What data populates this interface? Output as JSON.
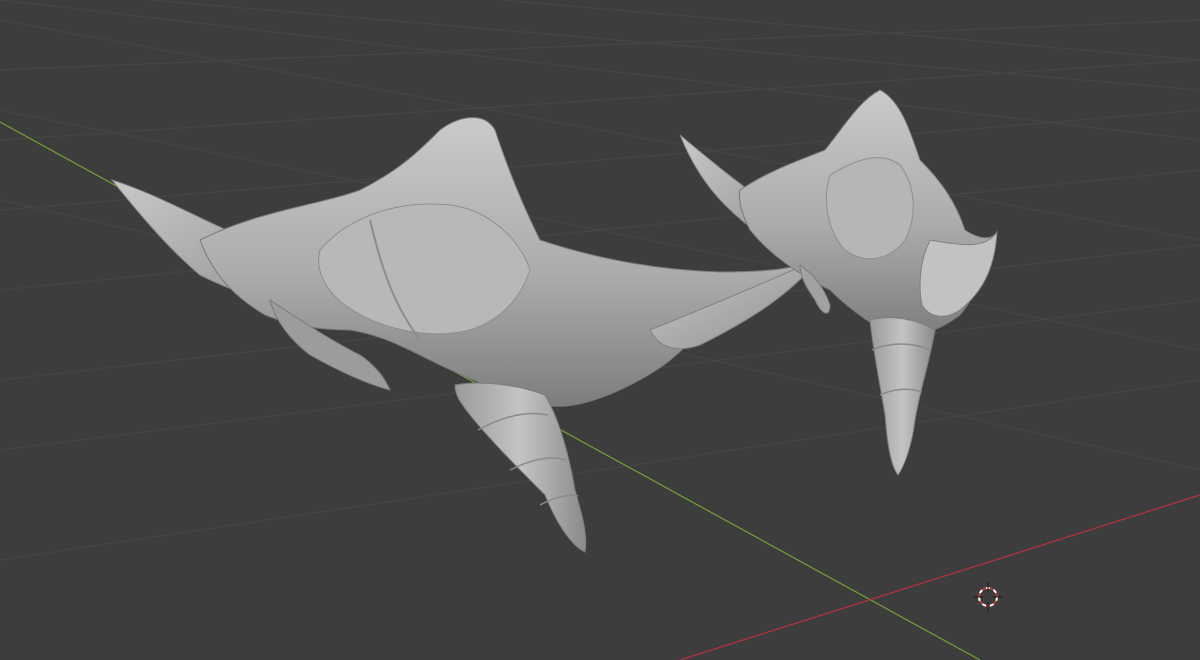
{
  "app": {
    "name": "3D viewport"
  },
  "viewport": {
    "background": "#3d3d3d",
    "grid_color": "#4a4a4a",
    "axis_x_color": "#b8323f",
    "axis_y_color": "#71a133",
    "model_base_color": "#a9a9a9",
    "model_shadow_color": "#777777",
    "model_highlight_color": "#cfcfcf"
  },
  "scene": {
    "objects": [
      {
        "type": "sculpted-mesh",
        "description_icon": "armor-piece-left"
      },
      {
        "type": "sculpted-mesh",
        "description_icon": "armor-piece-right"
      }
    ],
    "cursor_icon": "3d-cursor-icon"
  }
}
